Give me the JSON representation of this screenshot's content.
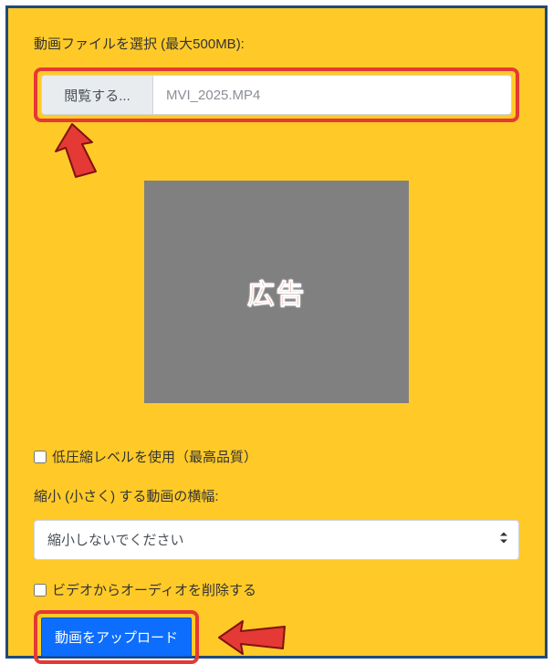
{
  "labels": {
    "select_file": "動画ファイルを選択 (最大500MB):",
    "browse": "閲覧する...",
    "file_name": "MVI_2025.MP4",
    "ad": "広告",
    "low_compress": "低圧縮レベルを使用（最高品質）",
    "width_label": "縮小 (小さく) する動画の横幅:",
    "select_value": "縮小しないでください",
    "remove_audio": "ビデオからオーディオを削除する",
    "upload": "動画をアップロード"
  },
  "checks": {
    "low_compress": false,
    "remove_audio": false
  },
  "colors": {
    "accent_red": "#e53935",
    "panel_bg": "#ffca28",
    "panel_border": "#1e4a7a",
    "primary_btn": "#0d6efd"
  }
}
